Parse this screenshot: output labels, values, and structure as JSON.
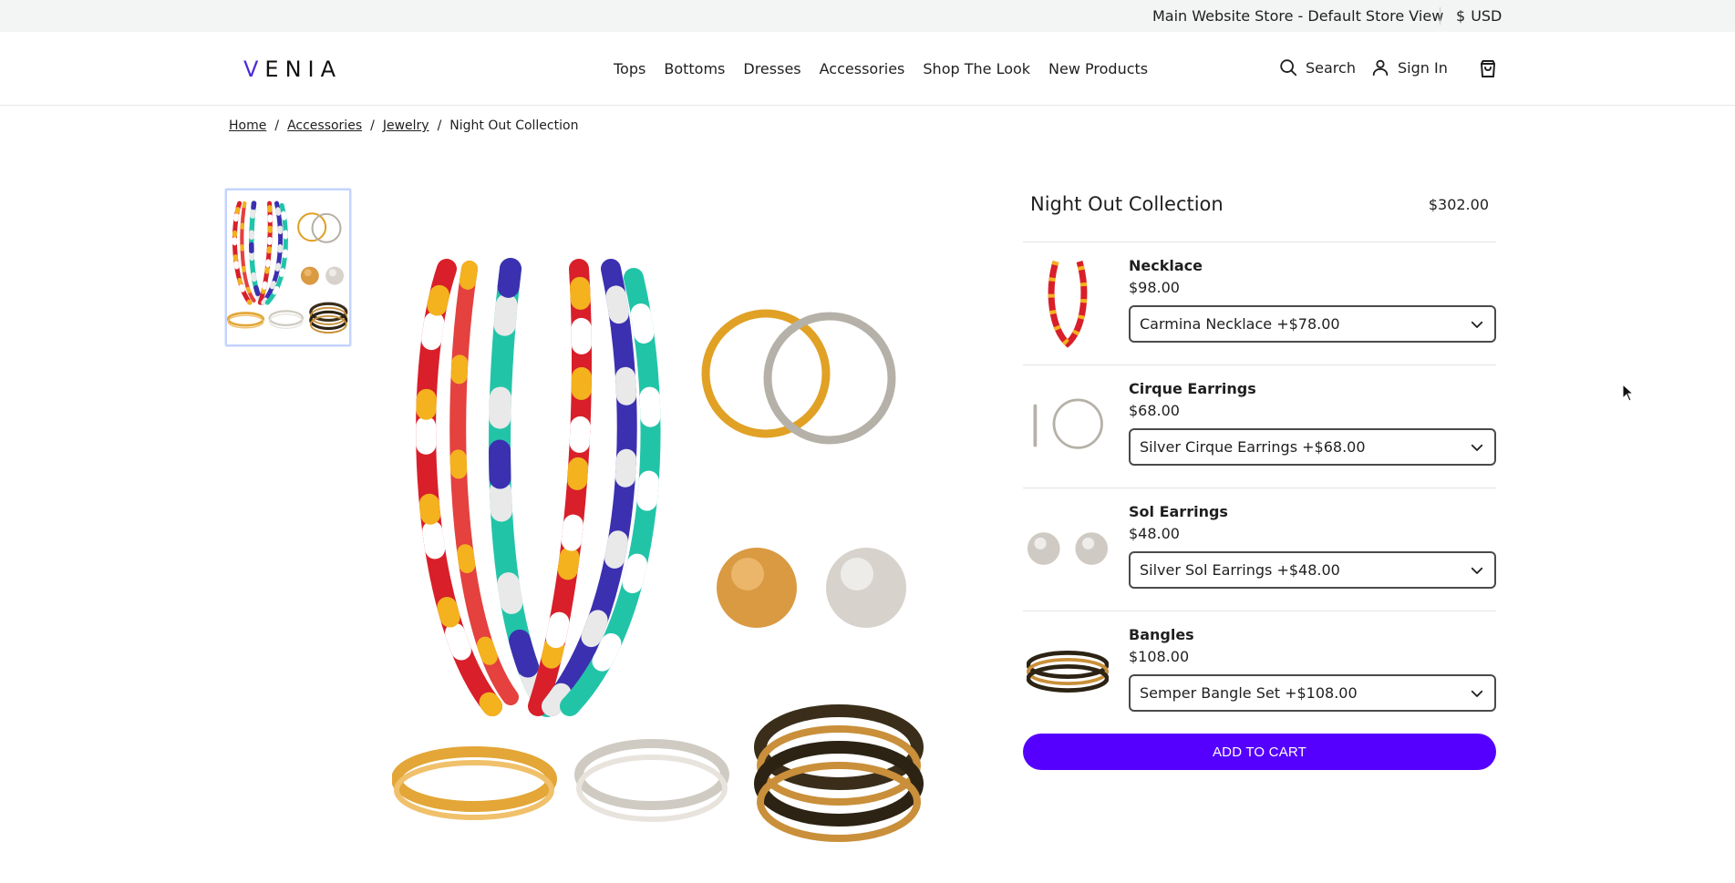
{
  "topbar": {
    "store": "Main Website Store - Default Store View",
    "currency_symbol": "$",
    "currency_code": "USD"
  },
  "header": {
    "logo": "VENIA",
    "nav": [
      "Tops",
      "Bottoms",
      "Dresses",
      "Accessories",
      "Shop The Look",
      "New Products"
    ],
    "search_label": "Search",
    "signin_label": "Sign In",
    "icons": {
      "search": "search-icon",
      "account": "user-icon",
      "cart": "shopping-bag-icon"
    }
  },
  "breadcrumb": {
    "links": [
      "Home",
      "Accessories",
      "Jewelry"
    ],
    "separator": "/",
    "current": "Night Out Collection"
  },
  "product": {
    "title": "Night Out Collection",
    "price": "$302.00",
    "items": [
      {
        "name": "Necklace",
        "price": "$98.00",
        "selected": "Carmina Necklace +$78.00"
      },
      {
        "name": "Cirque Earrings",
        "price": "$68.00",
        "selected": "Silver Cirque Earrings +$68.00"
      },
      {
        "name": "Sol Earrings",
        "price": "$48.00",
        "selected": "Silver Sol Earrings +$48.00"
      },
      {
        "name": "Bangles",
        "price": "$108.00",
        "selected": "Semper Bangle Set +$108.00"
      }
    ],
    "add_to_cart": "ADD TO CART"
  },
  "colors": {
    "accent": "#5500ff",
    "logo_v": "#4d2bd5",
    "topbar_bg": "#f3f4f4"
  }
}
